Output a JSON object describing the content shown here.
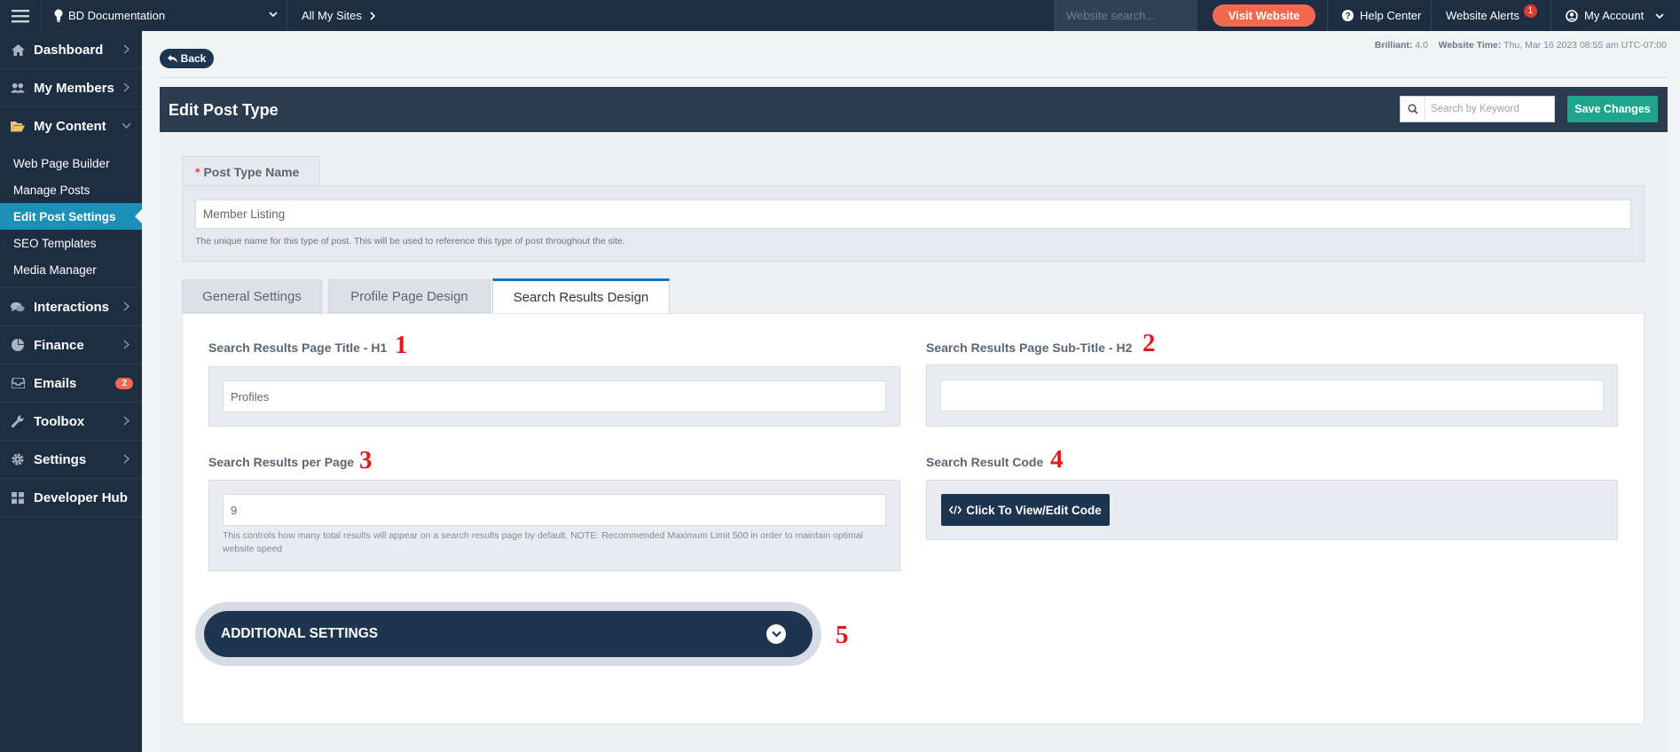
{
  "topbar": {
    "site_name": "BD Documentation",
    "all_sites": "All My Sites",
    "search_placeholder": "Website search...",
    "visit_website": "Visit Website",
    "help_center": "Help Center",
    "website_alerts": "Website Alerts",
    "alerts_count": "1",
    "my_account": "My Account"
  },
  "sidebar": {
    "dashboard": "Dashboard",
    "my_members": "My Members",
    "my_content": "My Content",
    "sub_items": [
      "Web Page Builder",
      "Manage Posts",
      "Edit Post Settings",
      "SEO Templates",
      "Media Manager"
    ],
    "active_sub": "Edit Post Settings",
    "interactions": "Interactions",
    "finance": "Finance",
    "emails": "Emails",
    "emails_badge": "2",
    "toolbox": "Toolbox",
    "settings": "Settings",
    "developer_hub": "Developer Hub"
  },
  "page": {
    "back": "Back",
    "brilliant_label": "Brilliant:",
    "brilliant_version": "4.0",
    "website_time_label": "Website Time:",
    "website_time": "Thu, Mar 16 2023 08:55 am UTC-07:00",
    "title": "Edit Post Type",
    "keyword_placeholder": "Search by Keyword",
    "save_changes": "Save Changes"
  },
  "post_type_name": {
    "required_mark": "*",
    "label": "Post Type Name",
    "value": "Member Listing",
    "help": "The unique name for this type of post. This will be used to reference this type of post throughout the site."
  },
  "tabs": [
    "General Settings",
    "Profile Page Design",
    "Search Results Design"
  ],
  "active_tab": "Search Results Design",
  "fields": {
    "h1_label": "Search Results Page Title - H1",
    "h1_value": "Profiles",
    "h2_label": "Search Results Page Sub-Title - H2",
    "h2_value": "",
    "per_page_label": "Search Results per Page",
    "per_page_value": "9",
    "per_page_help": "This controls how many total results will appear on a search results page by default. NOTE: Recommended Maximum Limit 500 in order to maintain optimal website speed",
    "code_label": "Search Result Code",
    "code_button": "Click To View/Edit Code"
  },
  "additional_settings": "ADDITIONAL SETTINGS",
  "annotations": [
    "1",
    "2",
    "3",
    "4",
    "5"
  ],
  "colors": {
    "navy": "#1e2e42",
    "active_blue": "#1b91b5",
    "visit_orange": "#f2694e",
    "save_green": "#1fa58d",
    "annotation_red": "#e01b1b"
  }
}
